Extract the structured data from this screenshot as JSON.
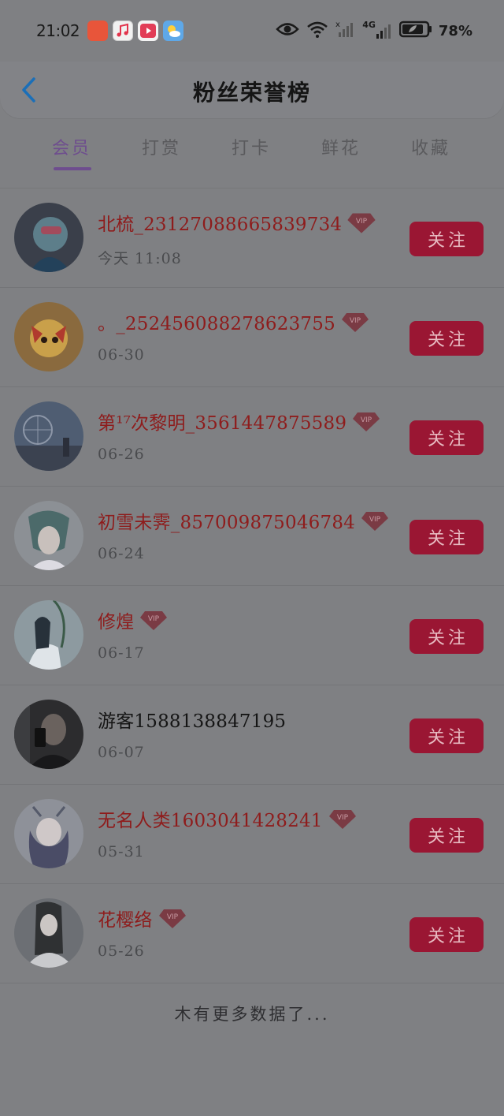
{
  "status_bar": {
    "time": "21:02",
    "network": "4G",
    "battery_percent": "78%"
  },
  "header": {
    "title": "粉丝荣誉榜"
  },
  "tabs": [
    {
      "label": "会员",
      "active": true
    },
    {
      "label": "打赏",
      "active": false
    },
    {
      "label": "打卡",
      "active": false
    },
    {
      "label": "鲜花",
      "active": false
    },
    {
      "label": "收藏",
      "active": false
    }
  ],
  "follow_label": "关注",
  "vip_label": "VIP",
  "fans": [
    {
      "name": "北梳_23127088665839734",
      "time": "今天 11:08",
      "vip": true
    },
    {
      "name": "。_252456088278623755",
      "time": "06-30",
      "vip": true
    },
    {
      "name": "第¹⁷次黎明_3561447875589",
      "time": "06-26",
      "vip": true
    },
    {
      "name": "初雪未霁_857009875046784",
      "time": "06-24",
      "vip": true
    },
    {
      "name": "修煌",
      "time": "06-17",
      "vip": true
    },
    {
      "name": "游客1588138847195",
      "time": "06-07",
      "vip": false
    },
    {
      "name": "无名人类1603041428241",
      "time": "05-31",
      "vip": true
    },
    {
      "name": "花樱络",
      "time": "05-26",
      "vip": true
    }
  ],
  "footer": {
    "no_more_text": "木有更多数据了..."
  },
  "colors": {
    "accent": "#6e4d8e",
    "vip_name": "#8e1c1c",
    "follow_button": "#9a1633"
  }
}
